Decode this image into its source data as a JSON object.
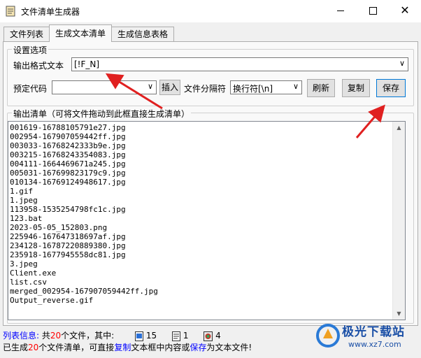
{
  "window": {
    "title": "文件清单生成器"
  },
  "tabs": [
    {
      "label": "文件列表",
      "active": false
    },
    {
      "label": "生成文本清单",
      "active": true
    },
    {
      "label": "生成信息表格",
      "active": false
    }
  ],
  "settings": {
    "legend": "设置选项",
    "format_label": "输出格式文本",
    "format_value": "[!F_N]",
    "preset_label": "预定代码",
    "preset_value": "",
    "insert_button": "插入",
    "separator_label": "文件分隔符",
    "separator_value": "换行符[\\n]",
    "refresh_button": "刷新",
    "copy_button": "复制",
    "save_button": "保存"
  },
  "output": {
    "legend": "输出清单（可将文件拖动到此框直接生成清单）",
    "lines": [
      "001619-16788105791e27.jpg",
      "002954-167907059442ff.jpg",
      "003033-16768242333b9e.jpg",
      "003215-16768243354083.jpg",
      "004111-1664469671a245.jpg",
      "005031-167699823179c9.jpg",
      "010134-16769124948617.jpg",
      "1.gif",
      "1.jpeg",
      "113958-1535254798fc1c.jpg",
      "123.bat",
      "2023-05-05_152803.png",
      "225946-167647318697af.jpg",
      "234128-16787220889380.jpg",
      "235918-1677945558dc81.jpg",
      "3.jpeg",
      "Client.exe",
      "list.csv",
      "merged_002954-167907059442ff.jpg",
      "Output_reverse.gif"
    ]
  },
  "status": {
    "line1_prefix": "列表信息:",
    "line1_a": "共",
    "line1_count": "20",
    "line1_b": "个文件，其中:",
    "img_count": "15",
    "doc_count": "1",
    "app_count": "4",
    "line2_a": "已生成",
    "line2_count": "20",
    "line2_b": "个文件清单，可直接",
    "line2_copy": "复制",
    "line2_c": "文本框中内容或",
    "line2_save": "保存",
    "line2_d": "为文本文件!"
  },
  "watermark": {
    "name": "极光下载站",
    "url": "www.xz7.com"
  },
  "colors": {
    "accent": "#0078d7",
    "arrow": "#e02020",
    "highlight_blue": "#0000ff",
    "highlight_red": "#ff0000"
  }
}
